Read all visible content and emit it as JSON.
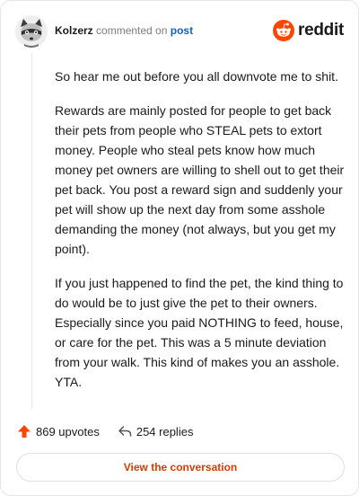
{
  "header": {
    "author": "Kolzerz",
    "action_text": "commented on",
    "post_link": "post",
    "logo_word": "reddit"
  },
  "comment": {
    "paragraphs": [
      "So hear me out before you all downvote me to shit.",
      "Rewards are mainly posted for people to get back their pets from people who STEAL pets to extort money. People who steal pets know how much money pet owners are willing to shell out to get their pet back. You post a reward sign and suddenly your pet will show up the next day from some asshole demanding the money (not always, but you get my point).",
      "If you just happened to find the pet, the kind thing to do would be to just give the pet to their owners. Especially since you paid NOTHING to feed, house, or care for the pet. This was a 5 minute deviation from your walk. This kind of makes you an asshole. YTA."
    ]
  },
  "stats": {
    "upvotes": "869 upvotes",
    "replies": "254 replies"
  },
  "cta": {
    "label": "View the conversation"
  },
  "colors": {
    "reddit_orange": "#ff4500",
    "link_blue": "#0a66c2",
    "cta_text": "#d93a00"
  },
  "icons": {
    "avatar": "raccoon-avatar",
    "logo": "reddit-logo-icon",
    "upvote": "upvote-arrow-icon",
    "reply": "reply-arrow-icon"
  }
}
